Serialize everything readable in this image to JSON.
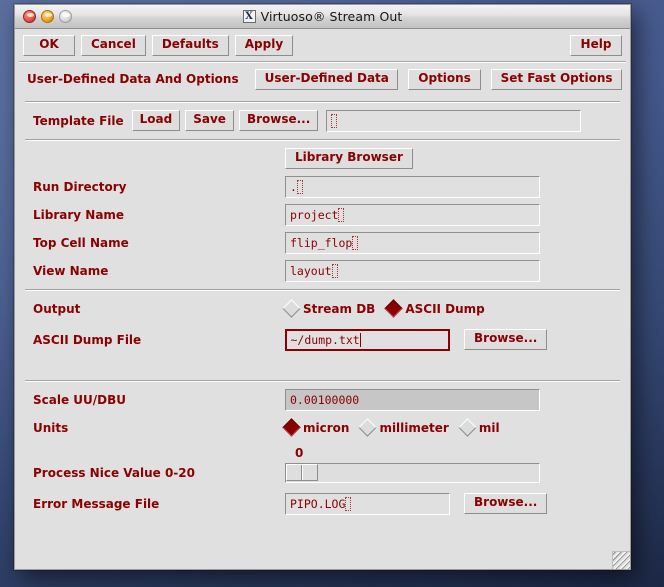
{
  "window": {
    "title": "Virtuoso® Stream Out",
    "app_icon": "x11-x-icon",
    "traffic_lights": {
      "close": "close-button",
      "minimize": "minimize-button",
      "zoom": "zoom-button"
    }
  },
  "actions": {
    "ok": "OK",
    "cancel": "Cancel",
    "defaults": "Defaults",
    "apply": "Apply",
    "help": "Help"
  },
  "tabs": {
    "group_label": "User-Defined Data And Options",
    "items": [
      {
        "label": "User-Defined Data"
      },
      {
        "label": "Options"
      },
      {
        "label": "Set Fast Options"
      }
    ]
  },
  "form": {
    "template_file": {
      "label": "Template File",
      "load": "Load",
      "save": "Save",
      "browse": "Browse...",
      "value": "",
      "placeholder": ""
    },
    "library_browser": {
      "label": "Library Browser"
    },
    "run_directory": {
      "label": "Run Directory",
      "value": "."
    },
    "library_name": {
      "label": "Library Name",
      "value": "project"
    },
    "top_cell_name": {
      "label": "Top Cell Name",
      "value": "flip_flop"
    },
    "view_name": {
      "label": "View Name",
      "value": "layout"
    },
    "output": {
      "label": "Output",
      "options": [
        {
          "label": "Stream DB",
          "selected": false
        },
        {
          "label": "ASCII Dump",
          "selected": true
        }
      ]
    },
    "ascii_dump_file": {
      "label": "ASCII Dump File",
      "value": "~/dump.txt",
      "browse": "Browse...",
      "focused": true
    },
    "scale_uu_dbu": {
      "label": "Scale UU/DBU",
      "value": "0.00100000",
      "readonly": true
    },
    "units": {
      "label": "Units",
      "options": [
        {
          "label": "micron",
          "selected": true
        },
        {
          "label": "millimeter",
          "selected": false
        },
        {
          "label": "mil",
          "selected": false
        }
      ]
    },
    "process_nice": {
      "label": "Process Nice Value 0-20",
      "value": "0",
      "min": 0,
      "max": 20
    },
    "error_message_file": {
      "label": "Error Message File",
      "value": "PIPO.LOG",
      "browse": "Browse..."
    }
  },
  "colors": {
    "label_text": "#8b0000",
    "window_bg": "#e0e0e0",
    "field_bg": "#e0e0e0",
    "readonly_bg": "#c6c6c6",
    "focus_border": "#8b0000",
    "desktop": "#41568a"
  }
}
